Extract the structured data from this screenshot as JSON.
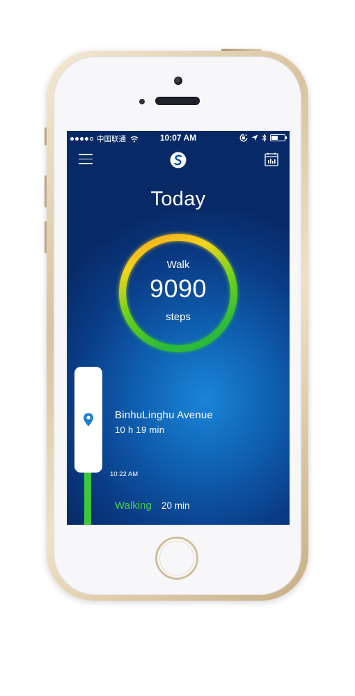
{
  "status_bar": {
    "carrier": "中国联通",
    "time": "10:07 AM",
    "signal_dots_filled": 4,
    "signal_dots_total": 5
  },
  "header": {
    "menu_icon": "hamburger-menu-icon",
    "logo_icon": "s-logo-icon",
    "calendar_icon": "calendar-chart-icon"
  },
  "page": {
    "title": "Today"
  },
  "activity_ring": {
    "label": "Walk",
    "value": "9090",
    "unit": "steps",
    "gradient_colors": [
      "#f5a21a",
      "#f2d51d",
      "#6fd21a",
      "#2cba3a"
    ]
  },
  "timeline": {
    "place": {
      "name": "BinhuLinghu Avenue",
      "duration": "10 h 19 min",
      "icon": "location-pin-icon"
    },
    "time_stamp": "10:22 AM",
    "activity": {
      "name": "Walking",
      "duration": "20 min",
      "color": "#45d14a"
    }
  },
  "colors": {
    "screen_bg_dark": "#072a66",
    "screen_bg_light": "#1a85d6",
    "timeline_green": "#3fc63f",
    "pin_blue": "#1d7fd3"
  }
}
